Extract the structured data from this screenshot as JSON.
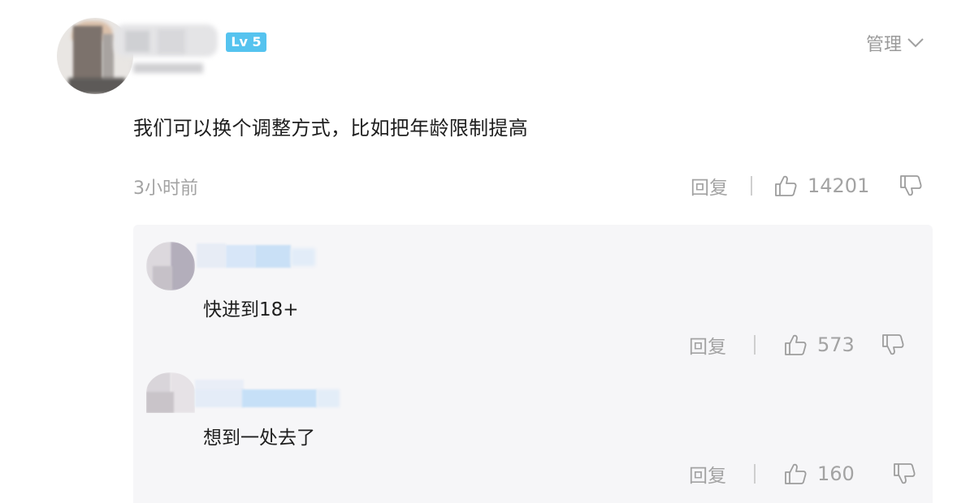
{
  "comment": {
    "level_badge": "Lv 5",
    "manage_label": "管理",
    "text": "我们可以换个调整方式，比如把年龄限制提高",
    "time": "3小时前",
    "reply_label": "回复",
    "like_count": "14201"
  },
  "replies": [
    {
      "text": "快进到18+",
      "reply_label": "回复",
      "like_count": "573"
    },
    {
      "text": "想到一处去了",
      "reply_label": "回复",
      "like_count": "160"
    }
  ],
  "icons": {
    "like": "thumbs-up-icon",
    "dislike": "thumbs-down-icon",
    "manage_arrow": "chevron-down-icon"
  },
  "colors": {
    "badge_bg": "#55c3ef",
    "muted_text": "#a3a3a3",
    "reply_panel_bg": "#f6f6f8"
  }
}
